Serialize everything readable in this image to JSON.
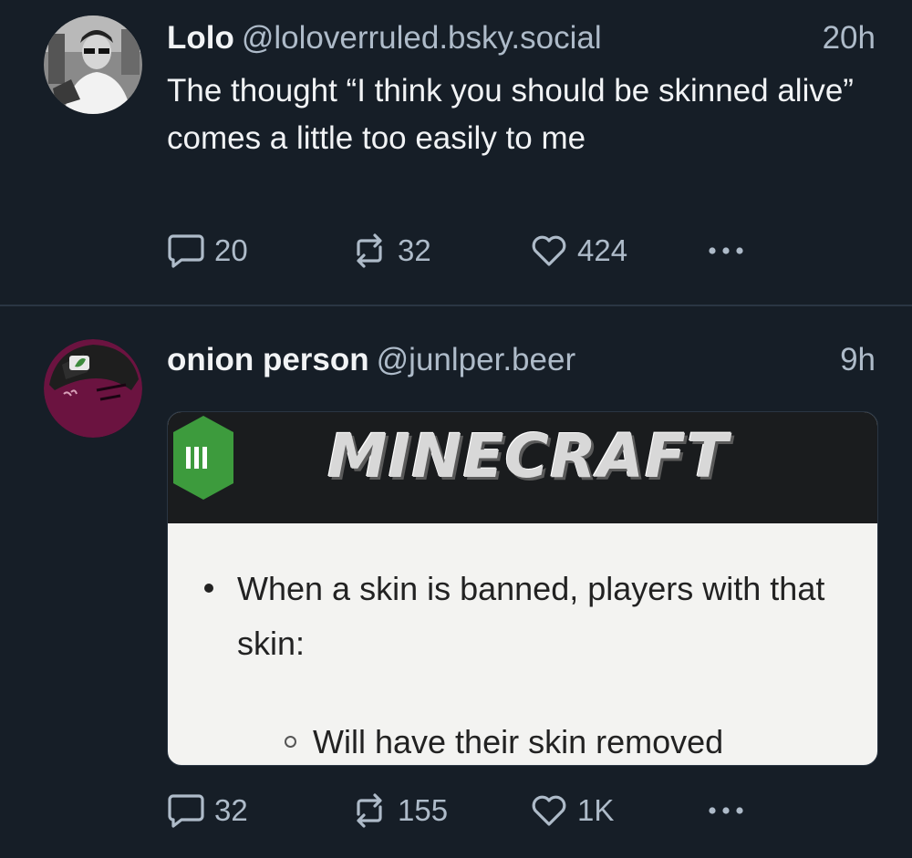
{
  "posts": [
    {
      "author_name": "Lolo",
      "handle": "@loloverruled.bsky.social",
      "time": "20h",
      "text": "The thought “I think you should be skinned alive” comes a little too easily to me",
      "replies": "20",
      "reposts": "32",
      "likes": "424"
    },
    {
      "author_name": "onion person",
      "handle": "@junlper.beer",
      "time": "9h",
      "media": {
        "logo": "MINECRAFT",
        "bullet": "When a skin is banned, players with that skin:",
        "sub_bullet": "Will have their skin removed"
      },
      "replies": "32",
      "reposts": "155",
      "likes": "1K"
    }
  ],
  "icons": {
    "reply": "speech-bubble-icon",
    "repost": "repost-arrows-icon",
    "like": "heart-icon",
    "more": "ellipsis-icon"
  },
  "colors": {
    "background": "#161e27",
    "muted_text": "#aebbc9",
    "divider": "#2a3643"
  }
}
